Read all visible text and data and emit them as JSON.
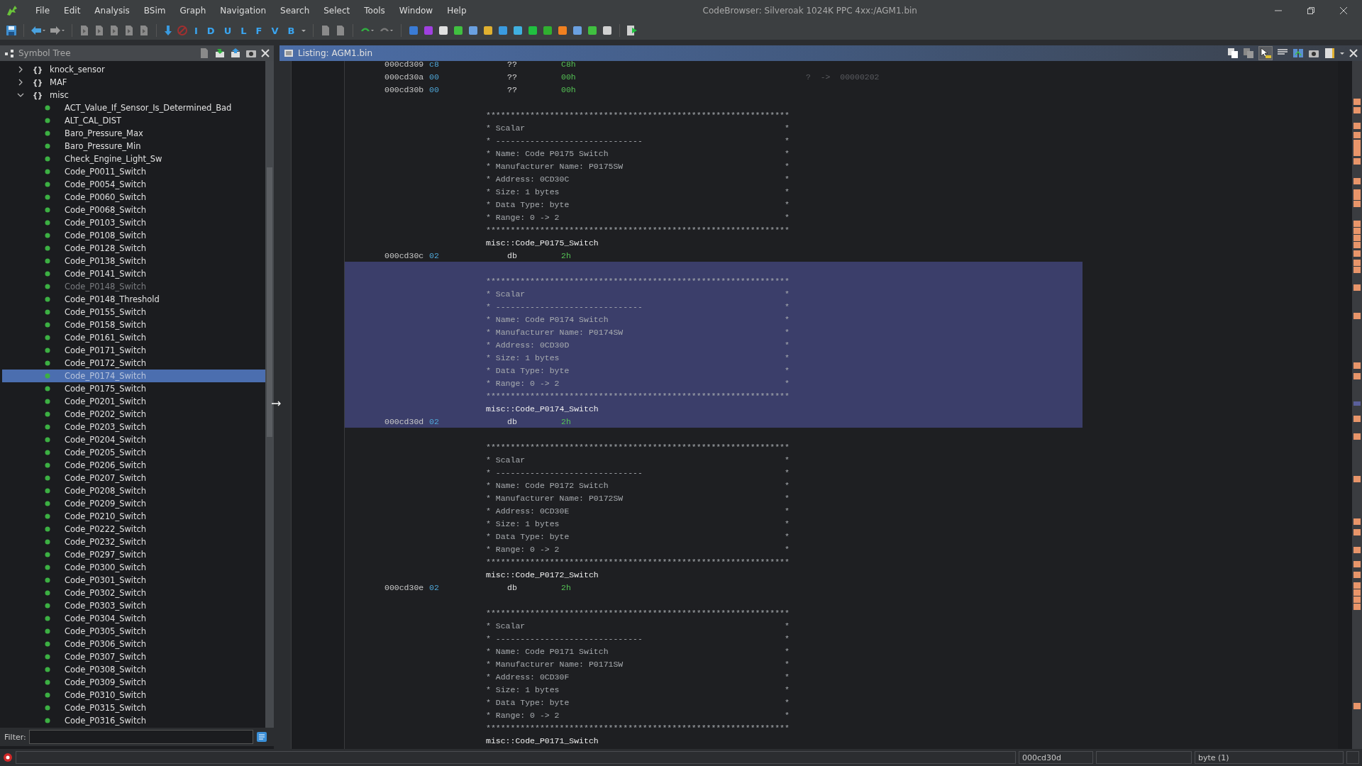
{
  "window": {
    "title": "CodeBrowser: Silveroak 1024K PPC 4xx:/AGM1.bin"
  },
  "menu": [
    "File",
    "Edit",
    "Analysis",
    "BSim",
    "Graph",
    "Navigation",
    "Search",
    "Select",
    "Tools",
    "Window",
    "Help"
  ],
  "toolbar_letters": [
    "I",
    "D",
    "U",
    "L",
    "F",
    "V",
    "B"
  ],
  "symbol_tree": {
    "title": "Symbol Tree",
    "nodes": [
      {
        "label": "knock_sensor",
        "glyph": "{}",
        "expanded": false
      },
      {
        "label": "MAF",
        "glyph": "{}",
        "expanded": false
      },
      {
        "label": "misc",
        "glyph": "{}",
        "expanded": true,
        "children": [
          {
            "label": "ACT_Value_If_Sensor_Is_Determined_Bad",
            "selected": false,
            "dimmed": false
          },
          {
            "label": "ALT_CAL_DIST",
            "selected": false,
            "dimmed": false
          },
          {
            "label": "Baro_Pressure_Max",
            "selected": false,
            "dimmed": false
          },
          {
            "label": "Baro_Pressure_Min",
            "selected": false,
            "dimmed": false
          },
          {
            "label": "Check_Engine_Light_Sw",
            "selected": false,
            "dimmed": false
          },
          {
            "label": "Code_P0011_Switch",
            "selected": false,
            "dimmed": false
          },
          {
            "label": "Code_P0054_Switch",
            "selected": false,
            "dimmed": false
          },
          {
            "label": "Code_P0060_Switch",
            "selected": false,
            "dimmed": false
          },
          {
            "label": "Code_P0068_Switch",
            "selected": false,
            "dimmed": false
          },
          {
            "label": "Code_P0103_Switch",
            "selected": false,
            "dimmed": false
          },
          {
            "label": "Code_P0108_Switch",
            "selected": false,
            "dimmed": false
          },
          {
            "label": "Code_P0128_Switch",
            "selected": false,
            "dimmed": false
          },
          {
            "label": "Code_P0138_Switch",
            "selected": false,
            "dimmed": false
          },
          {
            "label": "Code_P0141_Switch",
            "selected": false,
            "dimmed": false
          },
          {
            "label": "Code_P0148_Switch",
            "selected": false,
            "dimmed": true
          },
          {
            "label": "Code_P0148_Threshold",
            "selected": false,
            "dimmed": false
          },
          {
            "label": "Code_P0155_Switch",
            "selected": false,
            "dimmed": false
          },
          {
            "label": "Code_P0158_Switch",
            "selected": false,
            "dimmed": false
          },
          {
            "label": "Code_P0161_Switch",
            "selected": false,
            "dimmed": false
          },
          {
            "label": "Code_P0171_Switch",
            "selected": false,
            "dimmed": false
          },
          {
            "label": "Code_P0172_Switch",
            "selected": false,
            "dimmed": false
          },
          {
            "label": "Code_P0174_Switch",
            "selected": true,
            "dimmed": false
          },
          {
            "label": "Code_P0175_Switch",
            "selected": false,
            "dimmed": false
          },
          {
            "label": "Code_P0201_Switch",
            "selected": false,
            "dimmed": false
          },
          {
            "label": "Code_P0202_Switch",
            "selected": false,
            "dimmed": false
          },
          {
            "label": "Code_P0203_Switch",
            "selected": false,
            "dimmed": false
          },
          {
            "label": "Code_P0204_Switch",
            "selected": false,
            "dimmed": false
          },
          {
            "label": "Code_P0205_Switch",
            "selected": false,
            "dimmed": false
          },
          {
            "label": "Code_P0206_Switch",
            "selected": false,
            "dimmed": false
          },
          {
            "label": "Code_P0207_Switch",
            "selected": false,
            "dimmed": false
          },
          {
            "label": "Code_P0208_Switch",
            "selected": false,
            "dimmed": false
          },
          {
            "label": "Code_P0209_Switch",
            "selected": false,
            "dimmed": false
          },
          {
            "label": "Code_P0210_Switch",
            "selected": false,
            "dimmed": false
          },
          {
            "label": "Code_P0222_Switch",
            "selected": false,
            "dimmed": false
          },
          {
            "label": "Code_P0232_Switch",
            "selected": false,
            "dimmed": false
          },
          {
            "label": "Code_P0297_Switch",
            "selected": false,
            "dimmed": false
          },
          {
            "label": "Code_P0300_Switch",
            "selected": false,
            "dimmed": false
          },
          {
            "label": "Code_P0301_Switch",
            "selected": false,
            "dimmed": false
          },
          {
            "label": "Code_P0302_Switch",
            "selected": false,
            "dimmed": false
          },
          {
            "label": "Code_P0303_Switch",
            "selected": false,
            "dimmed": false
          },
          {
            "label": "Code_P0304_Switch",
            "selected": false,
            "dimmed": false
          },
          {
            "label": "Code_P0305_Switch",
            "selected": false,
            "dimmed": false
          },
          {
            "label": "Code_P0306_Switch",
            "selected": false,
            "dimmed": false
          },
          {
            "label": "Code_P0307_Switch",
            "selected": false,
            "dimmed": false
          },
          {
            "label": "Code_P0308_Switch",
            "selected": false,
            "dimmed": false
          },
          {
            "label": "Code_P0309_Switch",
            "selected": false,
            "dimmed": false
          },
          {
            "label": "Code_P0310_Switch",
            "selected": false,
            "dimmed": false
          },
          {
            "label": "Code_P0315_Switch",
            "selected": false,
            "dimmed": false
          },
          {
            "label": "Code_P0316_Switch",
            "selected": false,
            "dimmed": false
          }
        ]
      }
    ],
    "filter_label": "Filter:"
  },
  "listing": {
    "title": "Listing:  AGM1.bin",
    "top_lines": [
      {
        "address": "000cd309",
        "bytes": "c8",
        "mnemonic": "??",
        "operand": "C8h"
      },
      {
        "address": "000cd30a",
        "bytes": "00",
        "mnemonic": "??",
        "operand": "00h",
        "xref": "?  ->  00000202"
      },
      {
        "address": "000cd30b",
        "bytes": "00",
        "mnemonic": "??",
        "operand": "00h"
      }
    ],
    "blocks": [
      {
        "selected": false,
        "border": "**************************************************************",
        "lines": [
          "* Scalar                                                     *",
          "* ------------------------------                             *",
          "* Name: Code P0175 Switch                                    *",
          "* Manufacturer Name: P0175SW                                 *",
          "* Address: 0CD30C                                            *",
          "* Size: 1 bytes                                              *",
          "* Data Type: byte                                            *",
          "* Range: 0 -> 2                                              *"
        ],
        "border_end": "**************************************************************",
        "label": "misc::Code_P0175_Switch",
        "data": {
          "address": "000cd30c",
          "bytes": "02",
          "mnemonic": "db",
          "operand": "2h"
        }
      },
      {
        "selected": true,
        "border": "**************************************************************",
        "lines": [
          "* Scalar                                                     *",
          "* ------------------------------                             *",
          "* Name: Code P0174 Switch                                    *",
          "* Manufacturer Name: P0174SW                                 *",
          "* Address: 0CD30D                                            *",
          "* Size: 1 bytes                                              *",
          "* Data Type: byte                                            *",
          "* Range: 0 -> 2                                              *"
        ],
        "border_end": "**************************************************************",
        "label": "misc::Code_P0174_Switch",
        "data": {
          "address": "000cd30d",
          "bytes": "02",
          "mnemonic": "db",
          "operand": "2h"
        }
      },
      {
        "selected": false,
        "border": "**************************************************************",
        "lines": [
          "* Scalar                                                     *",
          "* ------------------------------                             *",
          "* Name: Code P0172 Switch                                    *",
          "* Manufacturer Name: P0172SW                                 *",
          "* Address: 0CD30E                                            *",
          "* Size: 1 bytes                                              *",
          "* Data Type: byte                                            *",
          "* Range: 0 -> 2                                              *"
        ],
        "border_end": "**************************************************************",
        "label": "misc::Code_P0172_Switch",
        "data": {
          "address": "000cd30e",
          "bytes": "02",
          "mnemonic": "db",
          "operand": "2h"
        }
      },
      {
        "selected": false,
        "border": "**************************************************************",
        "lines": [
          "* Scalar                                                     *",
          "* ------------------------------                             *",
          "* Name: Code P0171 Switch                                    *",
          "* Manufacturer Name: P0171SW                                 *",
          "* Address: 0CD30F                                            *",
          "* Size: 1 bytes                                              *",
          "* Data Type: byte                                            *",
          "* Range: 0 -> 2                                              *"
        ],
        "border_end": "**************************************************************",
        "label": "misc::Code_P0171_Switch"
      }
    ]
  },
  "status_bar": {
    "address": "000cd30d",
    "data_type": "byte (1)"
  }
}
